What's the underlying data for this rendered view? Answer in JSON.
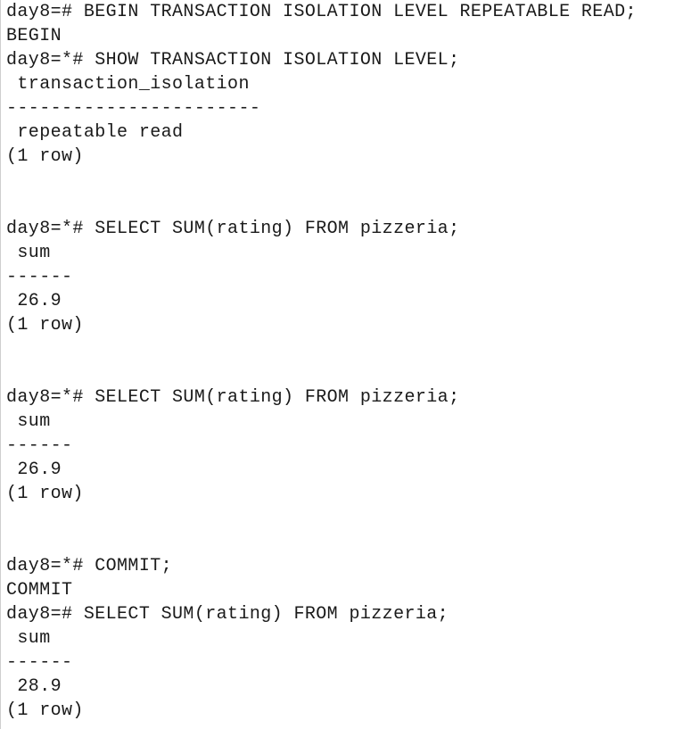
{
  "lines": [
    "day8=# BEGIN TRANSACTION ISOLATION LEVEL REPEATABLE READ;",
    "BEGIN",
    "day8=*# SHOW TRANSACTION ISOLATION LEVEL;",
    " transaction_isolation",
    "-----------------------",
    " repeatable read",
    "(1 row)",
    "",
    "",
    "day8=*# SELECT SUM(rating) FROM pizzeria;",
    " sum",
    "------",
    " 26.9",
    "(1 row)",
    "",
    "",
    "day8=*# SELECT SUM(rating) FROM pizzeria;",
    " sum",
    "------",
    " 26.9",
    "(1 row)",
    "",
    "",
    "day8=*# COMMIT;",
    "COMMIT",
    "day8=# SELECT SUM(rating) FROM pizzeria;",
    " sum",
    "------",
    " 28.9",
    "(1 row)"
  ]
}
